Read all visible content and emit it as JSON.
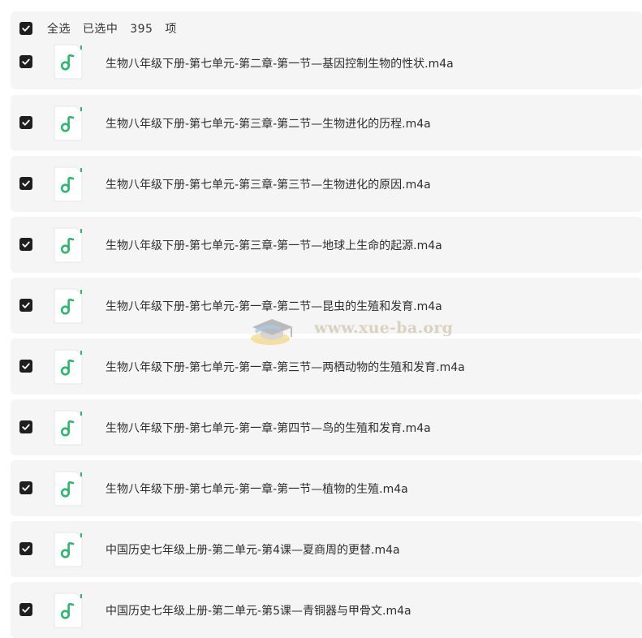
{
  "header": {
    "select_all_label": "全选",
    "selected_label": "已选中",
    "selected_count": "395",
    "items_unit": "项",
    "checked": true
  },
  "files": [
    {
      "name": "生物八年级下册-第七单元-第二章-第一节—基因控制生物的性状.m4a",
      "checked": true
    },
    {
      "name": "生物八年级下册-第七单元-第三章-第二节—生物进化的历程.m4a",
      "checked": true
    },
    {
      "name": "生物八年级下册-第七单元-第三章-第三节—生物进化的原因.m4a",
      "checked": true
    },
    {
      "name": "生物八年级下册-第七单元-第三章-第一节—地球上生命的起源.m4a",
      "checked": true
    },
    {
      "name": "生物八年级下册-第七单元-第一章-第二节—昆虫的生殖和发育.m4a",
      "checked": true
    },
    {
      "name": "生物八年级下册-第七单元-第一章-第三节—两栖动物的生殖和发育.m4a",
      "checked": true
    },
    {
      "name": "生物八年级下册-第七单元-第一章-第四节—鸟的生殖和发育.m4a",
      "checked": true
    },
    {
      "name": "生物八年级下册-第七单元-第一章-第一节—植物的生殖.m4a",
      "checked": true
    },
    {
      "name": "中国历史七年级上册-第二单元-第4课—夏商周的更替.m4a",
      "checked": true
    },
    {
      "name": "中国历史七年级上册-第二单元-第5课—青铜器与甲骨文.m4a",
      "checked": true
    }
  ],
  "icons": {
    "checkbox": "checkbox-checked-icon",
    "file": "audio-file-icon"
  },
  "colors": {
    "row_background": "#f5f5f6",
    "checkbox_fill": "#1f1f1f",
    "audio_icon_green": "#2fb66f"
  },
  "watermark": {
    "text": "www.xue-ba.org"
  }
}
